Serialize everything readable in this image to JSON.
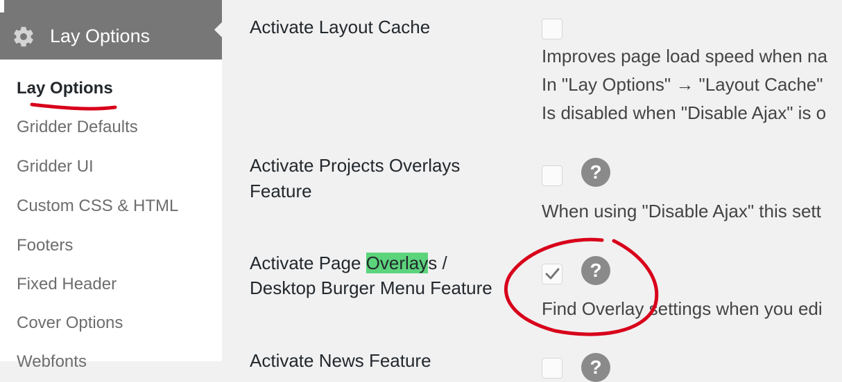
{
  "sidebar": {
    "menu_title": "Lay Options",
    "items": [
      {
        "label": "Lay Options",
        "current": true
      },
      {
        "label": "Gridder Defaults"
      },
      {
        "label": "Gridder UI"
      },
      {
        "label": "Custom CSS & HTML"
      },
      {
        "label": "Footers"
      },
      {
        "label": "Fixed Header"
      },
      {
        "label": "Cover Options"
      },
      {
        "label": "Webfonts"
      }
    ]
  },
  "settings": {
    "layout_cache": {
      "label": "Activate Layout Cache",
      "checked": false,
      "desc_lines": [
        "Improves page load speed when na",
        "In \"Lay Options\" → \"Layout Cache\"",
        "Is disabled when \"Disable Ajax\" is o"
      ]
    },
    "projects_overlays": {
      "label_line1": "Activate Projects Overlays",
      "label_line2": "Feature",
      "checked": false,
      "help": "?",
      "desc": "When using \"Disable Ajax\" this sett"
    },
    "page_overlays": {
      "label_pre": "Activate Page ",
      "label_highlight": "Overlay",
      "label_post": "s /",
      "label_line2": "Desktop Burger Menu Feature",
      "checked": true,
      "help": "?",
      "desc": "Find Overlay settings when you edi"
    },
    "news": {
      "label": "Activate News Feature",
      "help": "?"
    }
  },
  "colors": {
    "menu_header_bg": "#777777",
    "highlight": "#5cd47c",
    "annotation": "#d8001a"
  }
}
